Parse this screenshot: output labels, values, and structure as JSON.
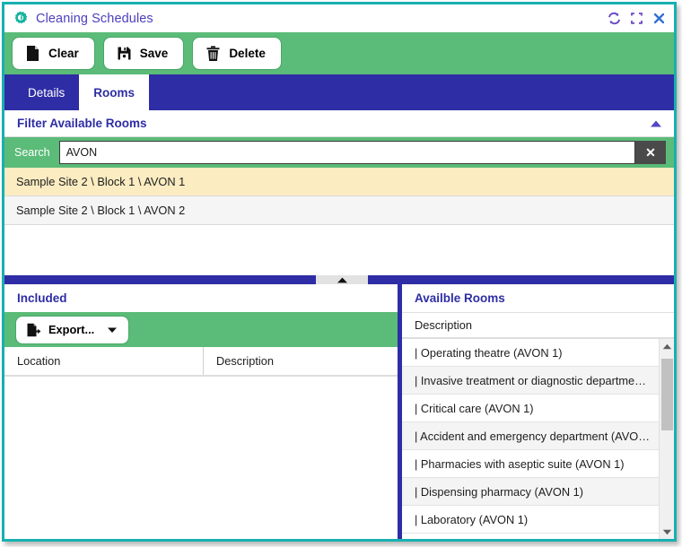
{
  "window": {
    "title": "Cleaning Schedules",
    "app_icon": "gear-icon",
    "controls": [
      {
        "name": "refresh-icon",
        "label": "Refresh"
      },
      {
        "name": "maximize-icon",
        "label": "Maximize"
      },
      {
        "name": "close-icon",
        "label": "Close"
      }
    ],
    "border_color": "#17b0b0"
  },
  "toolbar": {
    "background": "#5bbb78",
    "buttons": [
      {
        "label": "Clear",
        "icon": "document-icon"
      },
      {
        "label": "Save",
        "icon": "floppy-disk-icon"
      },
      {
        "label": "Delete",
        "icon": "trash-icon"
      }
    ]
  },
  "tabs": {
    "background": "#2e2da5",
    "items": [
      {
        "label": "Details",
        "active": false
      },
      {
        "label": "Rooms",
        "active": true
      }
    ]
  },
  "filter": {
    "title": "Filter Available Rooms",
    "collapse_icon": "triangle-up-icon",
    "search": {
      "label": "Search",
      "value": "AVON",
      "placeholder": "",
      "clear_label": "✕"
    },
    "results": [
      {
        "text": "Sample Site 2 \\ Block 1 \\ AVON 1",
        "selected": true
      },
      {
        "text": "Sample Site 2 \\ Block 1 \\ AVON 2",
        "selected": false
      }
    ]
  },
  "splitter": {
    "collapse_icon": "triangle-up-icon"
  },
  "included": {
    "title": "Included",
    "export_button": {
      "label": "Export...",
      "icon": "export-icon",
      "caret": "chevron-down-icon"
    },
    "columns": [
      "Location",
      "Description"
    ],
    "rows": []
  },
  "available": {
    "title": "Availble Rooms",
    "column": "Description",
    "rows": [
      "| Operating theatre (AVON 1)",
      "| Invasive treatment or diagnostic departme…",
      "| Critical care (AVON 1)",
      "| Accident and emergency department (AVO…",
      "| Pharmacies with aseptic suite (AVON 1)",
      "| Dispensing pharmacy (AVON 1)",
      "| Laboratory (AVON 1)"
    ],
    "scrollbar": {
      "up_icon": "triangle-up-icon",
      "down_icon": "triangle-down-icon"
    }
  },
  "colors": {
    "green": "#5bbb78",
    "blue": "#2e2da5",
    "teal": "#17b0b0",
    "highlight": "#fbecc1"
  }
}
